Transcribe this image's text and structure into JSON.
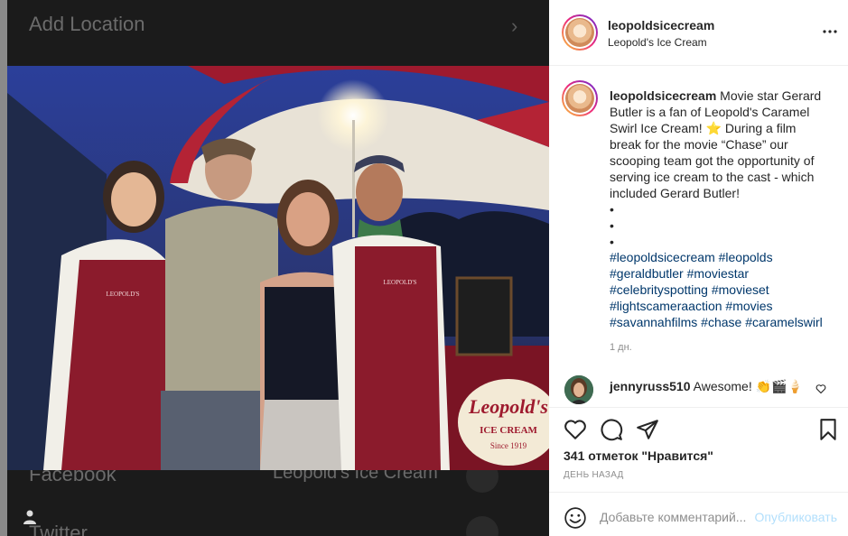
{
  "background": {
    "top_row": "Add Location",
    "rows": [
      {
        "label": "Facebook",
        "value": "Leopold's Ice Cream"
      },
      {
        "label": "Twitter"
      }
    ]
  },
  "post": {
    "username": "leopoldsicecream",
    "location": "Leopold's Ice Cream",
    "caption": {
      "username": "leopoldsicecream",
      "text": " Movie star Gerard Butler is a fan of Leopold's Caramel Swirl Ice Cream! ⭐ During a film break for the movie “Chase” our scooping team got the opportunity of serving ice cream to the cast - which included Gerard Butler!\n•\n•\n•",
      "hashtags": [
        "#leopoldsicecream",
        "#leopolds",
        "#geraldbutler",
        "#moviestar",
        "#celebrityspotting",
        "#movieset",
        "#lightscameraaction",
        "#movies",
        "#savannahfilms",
        "#chase",
        "#caramelswirl"
      ],
      "time": "1 дн."
    },
    "comments": [
      {
        "username": "jennyruss510",
        "text": " Awesome! 👏🎬🍦"
      }
    ],
    "likes": "341 отметок \"Нравится\"",
    "date": "ДЕНЬ НАЗАД",
    "comment_placeholder": "Добавьте комментарий...",
    "publish_label": "Опубликовать"
  },
  "photo_signage": {
    "umbrella_text": "",
    "cart_logo": "Leopold's",
    "cart_sub": "ICE CREAM",
    "cart_since": "Since 1919",
    "apron_text": "LEOPOLD'S"
  },
  "colors": {
    "accent_link": "#00376b",
    "publish_disabled": "#b2dffc",
    "secondary_text": "#8e8e8e"
  }
}
